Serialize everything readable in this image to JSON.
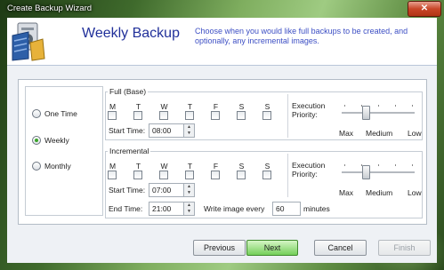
{
  "window": {
    "title": "Create Backup Wizard",
    "close_glyph": "✕"
  },
  "header": {
    "title": "Weekly Backup",
    "description": "Choose when you would like full backups to be created, and optionally, any incremental images.",
    "icon": "backup-wizard-icon"
  },
  "frequency": {
    "options": [
      {
        "label": "One Time",
        "selected": false
      },
      {
        "label": "Weekly",
        "selected": true
      },
      {
        "label": "Monthly",
        "selected": false
      }
    ]
  },
  "days": [
    "M",
    "T",
    "W",
    "T",
    "F",
    "S",
    "S"
  ],
  "full": {
    "title": "Full (Base)",
    "start_time_label": "Start Time:",
    "start_time": "08:00",
    "days_checked": [
      false,
      false,
      false,
      false,
      false,
      false,
      false
    ]
  },
  "incremental": {
    "title": "Incremental",
    "start_time_label": "Start Time:",
    "start_time": "07:00",
    "end_time_label": "End Time:",
    "end_time": "21:00",
    "write_label": "Write image every",
    "write_value": "60",
    "write_unit": "minutes",
    "days_checked": [
      false,
      false,
      false,
      false,
      false,
      false,
      false
    ]
  },
  "priority": {
    "label_line1": "Execution",
    "label_line2": "Priority:",
    "levels": [
      "Max",
      "Medium",
      "Low"
    ],
    "full_value": "Medium",
    "incremental_value": "Medium"
  },
  "footer": {
    "previous": "Previous",
    "next": "Next",
    "cancel": "Cancel",
    "finish": "Finish"
  }
}
